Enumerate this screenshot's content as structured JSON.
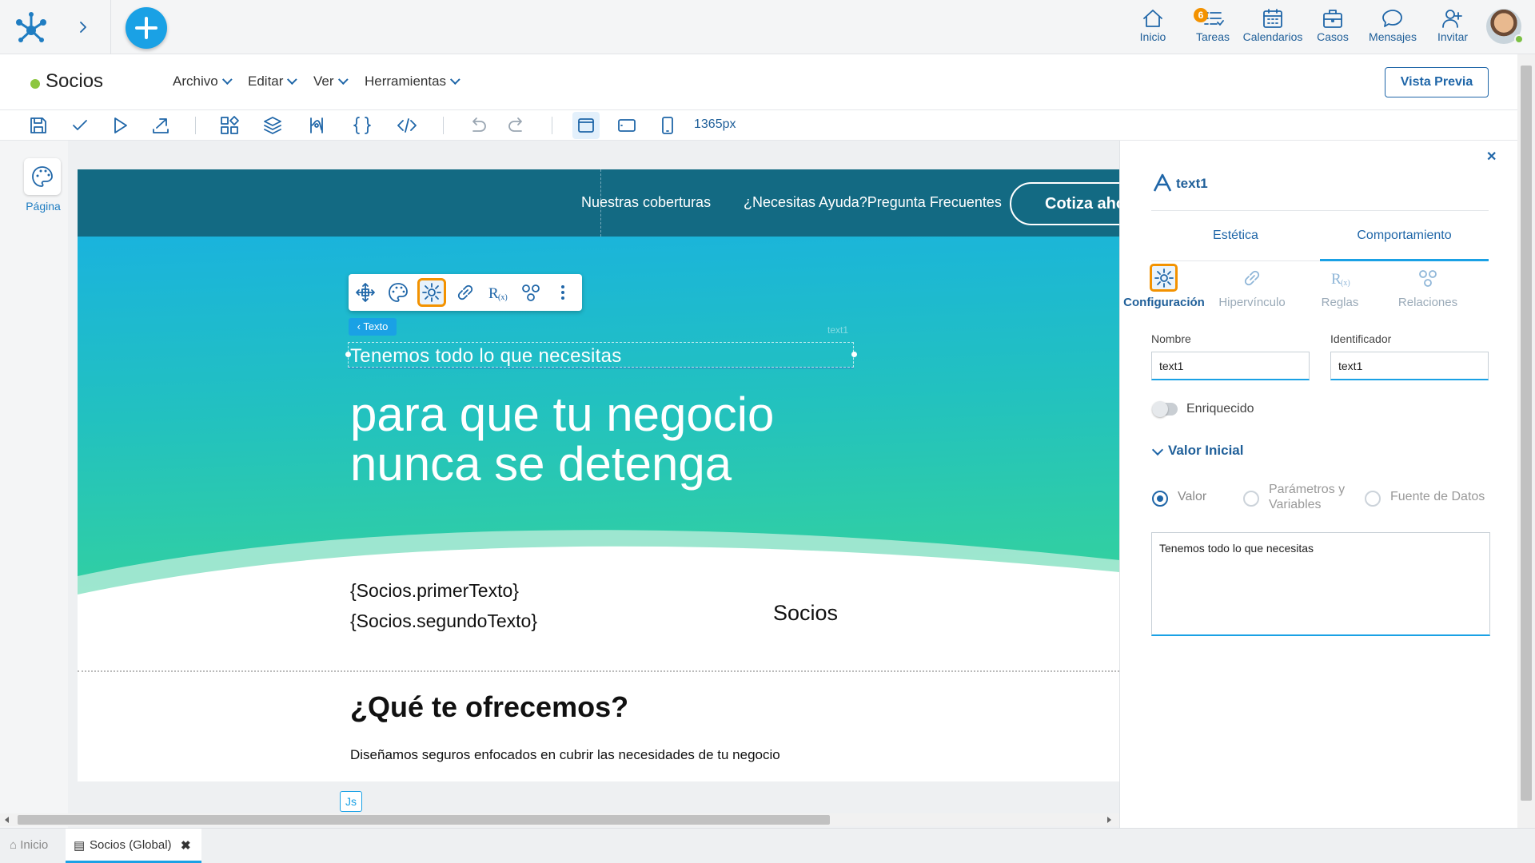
{
  "topnav": {
    "items": [
      {
        "label": "Inicio",
        "icon": "home-icon"
      },
      {
        "label": "Tareas",
        "icon": "tasks-icon",
        "badge": "6"
      },
      {
        "label": "Calendarios",
        "icon": "calendar-icon"
      },
      {
        "label": "Casos",
        "icon": "briefcase-icon"
      },
      {
        "label": "Mensajes",
        "icon": "chat-icon"
      },
      {
        "label": "Invitar",
        "icon": "invite-user-icon"
      }
    ]
  },
  "app": {
    "title": "Socios",
    "menus": [
      "Archivo",
      "Editar",
      "Ver",
      "Herramientas"
    ],
    "preview_label": "Vista Previa"
  },
  "toolbar": {
    "width_value": "1365px"
  },
  "rail": {
    "page_label": "Página"
  },
  "site": {
    "nav": [
      "Nuestras coberturas",
      "¿Necesitas Ayuda?Pregunta Frecuentes"
    ],
    "cta": "Cotiza ahora",
    "hero_small": "Tenemos todo lo que necesitas",
    "hero_big_line1": "para que tu negocio",
    "hero_big_line2": "nunca se detenga",
    "ghost_label": "text1",
    "template_line1": "{Socios.primerTexto}",
    "template_line2": "{Socios.segundoTexto}",
    "socios_label": "Socios",
    "section_title": "¿Qué te ofrecemos?",
    "section_text": "Diseñamos seguros enfocados en cubrir las necesidades de tu negocio"
  },
  "context": {
    "breadcrumb": "Texto",
    "js_label": "Js"
  },
  "panel": {
    "element_name": "text1",
    "tabs": [
      "Estética",
      "Comportamiento"
    ],
    "subtabs": [
      "Configuración",
      "Hipervínculo",
      "Reglas",
      "Relaciones"
    ],
    "nombre_label": "Nombre",
    "nombre_value": "text1",
    "identificador_label": "Identificador",
    "identificador_value": "text1",
    "enriquecido_label": "Enriquecido",
    "valor_inicial_label": "Valor Inicial",
    "radio_valor": "Valor",
    "radio_params_line1": "Parámetros y",
    "radio_params_line2": "Variables",
    "radio_fuente": "Fuente de Datos",
    "valor_text": "Tenemos todo lo que necesitas"
  },
  "bottom_tabs": {
    "home": "Inicio",
    "active": "Socios (Global)"
  },
  "colors": {
    "accent": "#1aa1e5",
    "brand_dark": "#1f66a8",
    "highlight": "#f39200",
    "site_nav": "#136a83"
  }
}
